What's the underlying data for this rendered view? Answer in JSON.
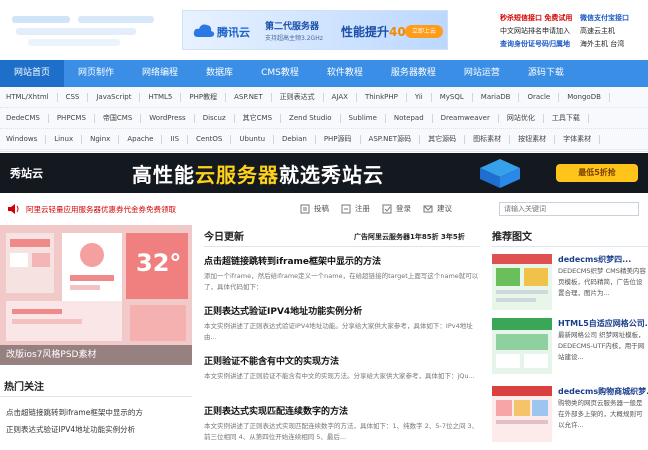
{
  "header": {
    "ad": {
      "brand": "腾讯云",
      "line1": "第二代服务器",
      "line2": "支持超高主频3.2GHz",
      "perf_prefix": "性能提升",
      "perf_value": "40%",
      "cta": "立即上云"
    },
    "links": [
      {
        "text": "秒杀短信接口 免费试用",
        "style": "red"
      },
      {
        "text": "微信支付宝接口",
        "style": "blue"
      },
      {
        "text": "中文网站排名申请加入",
        "style": "dark"
      },
      {
        "text": "高速云主机",
        "style": "dark"
      },
      {
        "text": "查询身份证号码归属地",
        "style": "blue"
      },
      {
        "text": "海外主机 台湾",
        "style": "dark"
      }
    ]
  },
  "nav": [
    "网站首页",
    "网页制作",
    "网络编程",
    "数据库",
    "CMS教程",
    "软件教程",
    "服务器教程",
    "网站运营",
    "源码下载"
  ],
  "tags": [
    [
      "HTML/Xhtml",
      "CSS",
      "JavaScript",
      "HTML5",
      "PHP教程",
      "ASP.NET",
      "正则表达式",
      "AJAX",
      "ThinkPHP",
      "Yii",
      "MySQL",
      "MariaDB",
      "Oracle",
      "MongoDB"
    ],
    [
      "DedeCMS",
      "PHPCMS",
      "帝国CMS",
      "WordPress",
      "Discuz",
      "其它CMS",
      "Zend Studio",
      "Sublime",
      "Notepad",
      "Dreamweaver",
      "网站优化",
      "工具下载"
    ],
    [
      "Windows",
      "Linux",
      "Nginx",
      "Apache",
      "IIS",
      "CentOS",
      "Ubuntu",
      "Debian",
      "PHP源码",
      "ASP.NET源码",
      "其它源码",
      "图标素材",
      "按钮素材",
      "字体素材"
    ]
  ],
  "banner": {
    "logo": "秀站云",
    "text_white_1": "高性能",
    "text_yellow": "云服务器",
    "text_white_2": "就选秀站云",
    "cta": "最低5折抢"
  },
  "notice": {
    "text": "阿里云轻量应用服务器优惠券代金券免费领取",
    "actions": [
      "投稿",
      "注册",
      "登录",
      "建议"
    ],
    "search_placeholder": "请输入关键词"
  },
  "left": {
    "hero_caption": "改版ios7风格PSD素材",
    "hero_number": "32°",
    "hot_title": "热门关注",
    "hot_items": [
      "点击超链接跳转到iframe框架中显示的方",
      "正则表达式验证IPV4地址功能实例分析"
    ]
  },
  "middle": {
    "title": "今日更新",
    "ad_text": "广告阿里云服务器1年85折 3年5折",
    "articles": [
      {
        "title": "点击超链接跳转到iframe框架中显示的方法",
        "desc": "添加一个iframe，然后给iframe定义一个name，在给超链接的target上面写这个name就可以了，具体代码如下："
      },
      {
        "title": "正则表达式验证IPV4地址功能实例分析",
        "desc": "本文实例讲述了正则表达式验证IPV4地址功能。分享给大家供大家参考，具体如下：IPv4地址由..."
      },
      {
        "title": "正则验证不能含有中文的实现方法",
        "desc": "本文实例讲述了正则验证不能含有中文的实现方法。分享给大家供大家参考，具体如下：jQu..."
      },
      {
        "title": "正则表达式实现匹配连续数字的方法",
        "desc": "本文实例讲述了正则表达式实现匹配连续数字的方法，具体如下：1、纯数字 2、5-7位之间 3、前三位相同 4、从第四位开始连续相同 5、最后..."
      }
    ]
  },
  "right": {
    "title": "推荐图文",
    "items": [
      {
        "title": "dedecms织梦四...",
        "desc": "DEDECMS织梦 CMS精美内容页模板，代码精简，广告位设置合理，图片为..."
      },
      {
        "title": "HTML5自适应网格公司...",
        "desc": "最新网格公司 织梦网址模板，DEDECMS-UTF内核，用于网站建设..."
      },
      {
        "title": "dedecms购物商城织梦...",
        "desc": "购物类的网页云服务器一般是在外部多上架的，大概规则可以允许..."
      }
    ]
  }
}
